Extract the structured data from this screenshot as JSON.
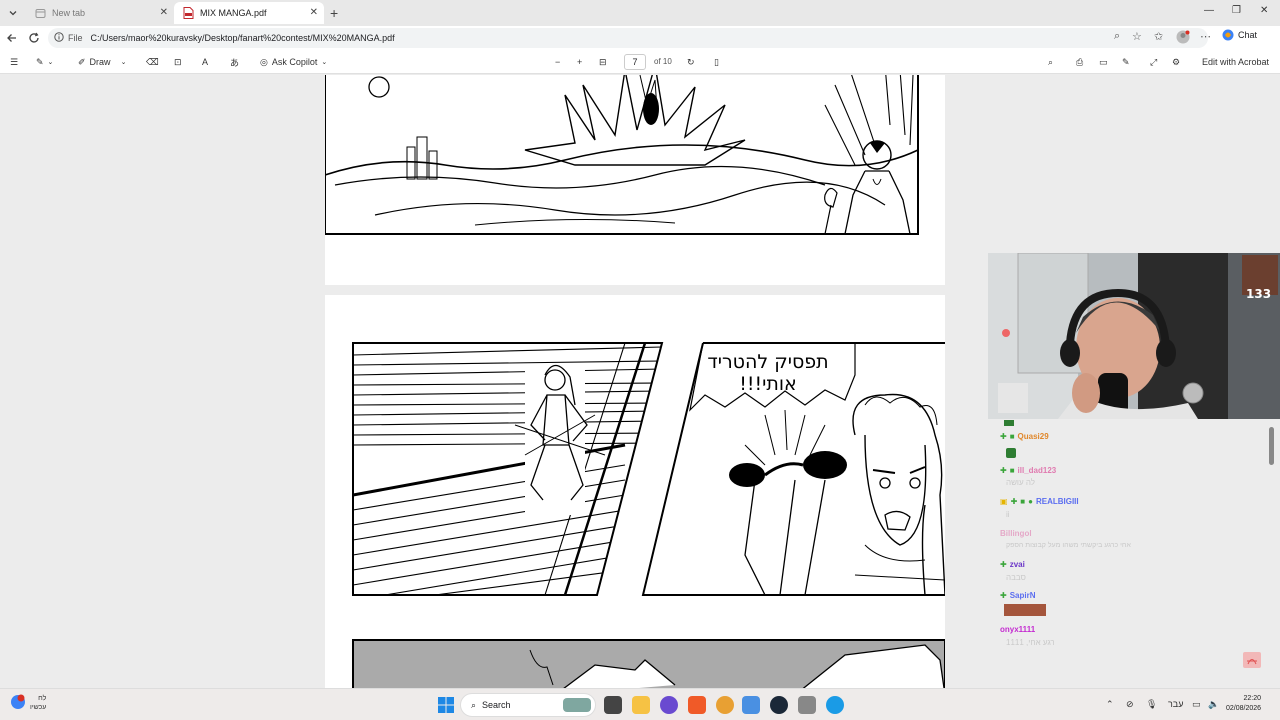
{
  "tabs": [
    {
      "title": "New tab",
      "active": false
    },
    {
      "title": "MIX MANGA.pdf",
      "active": true
    }
  ],
  "address": {
    "protocol": "File",
    "url": "C:/Users/maor%20kuravsky/Desktop/fanart%20contest/MIX%20MANGA.pdf",
    "chat_label": "Chat"
  },
  "pdf_toolbar": {
    "draw_label": "Draw",
    "ask_copilot_label": "Ask Copilot",
    "page_current": "7",
    "page_total": "of 10",
    "edit_acrobat_label": "Edit with Acrobat"
  },
  "manga": {
    "speech_line1": "תפסיק להטריד",
    "speech_line2": "אותי!!!"
  },
  "webcam": {
    "badge": "133"
  },
  "chat": [
    {
      "user": "Quasi29",
      "color": "#e0882c",
      "message": ""
    },
    {
      "user": "ill_dad123",
      "color": "#e07bb0",
      "message": "לה עושה"
    },
    {
      "user": "REALBIGIII",
      "color": "#5b6ef0",
      "message": "ii"
    },
    {
      "user": "Billingol",
      "color": "#e07bb0",
      "message": "אחי כרגע ביקשתי משהו מעל קבוצות הספק"
    },
    {
      "user": "zvai",
      "color": "#6b36c8",
      "message": "סבבה"
    },
    {
      "user": "SapirN",
      "color": "#5b6ef0",
      "message": ""
    },
    {
      "user": "onyx1111",
      "color": "#c42ad0",
      "message": "רגע אחי, 1111"
    }
  ],
  "taskbar": {
    "weather_temp": "לח",
    "weather_desc": "עכשיו",
    "search_label": "Search",
    "lang": "עבר",
    "time": "22:20",
    "date": "02/08/2026"
  }
}
